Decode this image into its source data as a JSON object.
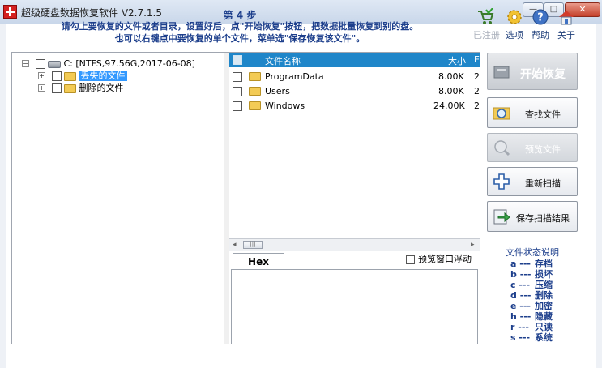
{
  "window": {
    "title": "超级硬盘数据恢复软件 V2.7.1.5",
    "minimize_glyph": "—",
    "maximize_glyph": "□",
    "close_glyph": "✕"
  },
  "instructions": {
    "step": "第 4 步",
    "line1": "请勾上要恢复的文件或者目录，设置好后，点\"开始恢复\"按钮，把数据批量恢复到别的盘。",
    "line2": "也可以右键点中要恢复的单个文件，菜单选\"保存恢复该文件\"。"
  },
  "top_icons": [
    {
      "label": "已注册",
      "icon": "cart-icon",
      "enabled": false
    },
    {
      "label": "选项",
      "icon": "gear-icon",
      "enabled": true
    },
    {
      "label": "帮助",
      "icon": "help-icon",
      "enabled": true
    },
    {
      "label": "关于",
      "icon": "home-icon",
      "enabled": true
    }
  ],
  "tree": {
    "root": {
      "label": "C:  [NTFS,97.56G,2017-06-08]",
      "expander": "−"
    },
    "children": [
      {
        "label": "丢失的文件",
        "selected": true,
        "expander": "+"
      },
      {
        "label": "删除的文件",
        "selected": false,
        "expander": "+"
      }
    ]
  },
  "file_list": {
    "columns": {
      "name": "文件名称",
      "size": "大小",
      "extra": "E"
    },
    "rows": [
      {
        "name": "ProgramData",
        "size": "8.00K",
        "extra": "2"
      },
      {
        "name": "Users",
        "size": "8.00K",
        "extra": "2"
      },
      {
        "name": "Windows",
        "size": "24.00K",
        "extra": "2"
      }
    ]
  },
  "scrollbar": {
    "left_arrow": "◂",
    "right_arrow": "▸",
    "thumb_grip": "|||"
  },
  "hex_panel": {
    "tab_label": "Hex",
    "float_option": "预览窗口浮动",
    "float_checked": false
  },
  "actions": {
    "start": "开始恢复",
    "find": "查找文件",
    "preview": "预览文件",
    "rescan": "重新扫描",
    "save": "保存扫描结果"
  },
  "status_legend": {
    "title": "文件状态说明",
    "items": [
      {
        "key": "a ---",
        "desc": "存档"
      },
      {
        "key": "b ---",
        "desc": "损坏"
      },
      {
        "key": "c ---",
        "desc": "压缩"
      },
      {
        "key": "d ---",
        "desc": "删除"
      },
      {
        "key": "e ---",
        "desc": "加密"
      },
      {
        "key": "h ---",
        "desc": "隐藏"
      },
      {
        "key": "r ---",
        "desc": "只读"
      },
      {
        "key": "s ---",
        "desc": "系统"
      }
    ]
  },
  "colors": {
    "accent": "#1f86c9",
    "instruction_text": "#1d3f8c",
    "selection": "#3399ff"
  }
}
